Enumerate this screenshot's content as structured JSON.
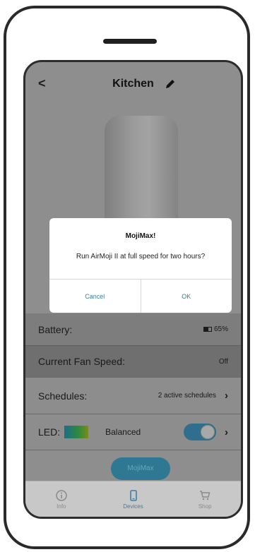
{
  "header": {
    "back_symbol": "<",
    "title": "Kitchen"
  },
  "rows": {
    "battery": {
      "label": "Battery:",
      "value": "65%"
    },
    "fan": {
      "label": "Current Fan Speed:",
      "value": "Off"
    },
    "schedules": {
      "label": "Schedules:",
      "value": "2 active schedules"
    },
    "led": {
      "label": "LED:",
      "mode": "Balanced",
      "toggle_on": true
    }
  },
  "mojimax_button": "MojiMax",
  "tabs": [
    {
      "label": "Info",
      "icon": "info-icon"
    },
    {
      "label": "Devices",
      "icon": "device-icon",
      "active": true
    },
    {
      "label": "Shop",
      "icon": "cart-icon"
    }
  ],
  "dialog": {
    "title": "MojiMax!",
    "message": "Run AirMoji II at full speed for two hours?",
    "cancel": "Cancel",
    "ok": "OK"
  },
  "colors": {
    "accent": "#3b7fa7",
    "overlay": "#8e8e8e"
  }
}
